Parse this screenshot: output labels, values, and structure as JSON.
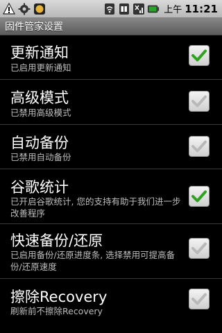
{
  "status_bar": {
    "ampm": "上午",
    "time": "11:21",
    "left_icons": [
      "warning-icon",
      "settings-icon",
      "notification-icon"
    ],
    "right_icons": [
      "wifi-icon",
      "sim-icon",
      "signal-icon",
      "battery-icon"
    ]
  },
  "title_bar": {
    "title": "固件管家设置"
  },
  "preferences": [
    {
      "title": "更新通知",
      "summary": "已启用更新通知",
      "checked": true
    },
    {
      "title": "高级模式",
      "summary": "已禁用高级模式",
      "checked": false
    },
    {
      "title": "自动备份",
      "summary": "已禁用自动备份",
      "checked": false
    },
    {
      "title": "谷歌统计",
      "summary": "已开启谷歌统计, 您的支持有助于我们进一步改善程序",
      "checked": true
    },
    {
      "title": "快速备份/还原",
      "summary": "已启用备份/还原进度条, 选择禁用可提高备份/还原速度",
      "checked": false
    },
    {
      "title": "擦除Recovery",
      "summary": "刷新前不擦除Recovery",
      "checked": false
    }
  ],
  "colors": {
    "check_on": "#2fa31f",
    "check_off": "#b9b9b9",
    "title_bar": "#6e6e6e",
    "status_bar": "#c9c9c9"
  }
}
